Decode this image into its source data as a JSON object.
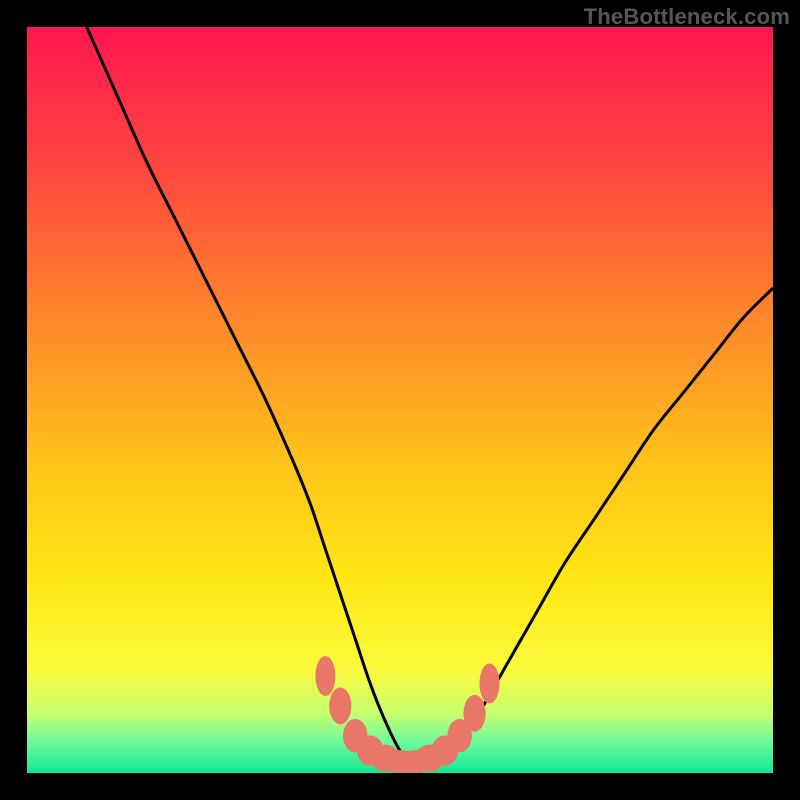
{
  "watermark": "TheBottleneck.com",
  "chart_data": {
    "type": "line",
    "title": "",
    "xlabel": "",
    "ylabel": "",
    "xlim": [
      0,
      100
    ],
    "ylim": [
      0,
      100
    ],
    "series": [
      {
        "name": "bottleneck-curve",
        "x": [
          8,
          12,
          16,
          20,
          24,
          28,
          32,
          36,
          38,
          40,
          42,
          44,
          46,
          48,
          50,
          52,
          54,
          56,
          58,
          60,
          64,
          68,
          72,
          76,
          80,
          84,
          88,
          92,
          96,
          100
        ],
        "y": [
          100,
          91,
          82,
          74,
          66,
          58,
          50,
          41,
          36,
          30,
          24,
          18,
          12,
          7,
          3,
          1,
          1,
          2,
          4,
          7,
          14,
          21,
          28,
          34,
          40,
          46,
          51,
          56,
          61,
          65
        ]
      },
      {
        "name": "marker-band",
        "x": [
          40,
          42,
          44,
          46,
          48,
          50,
          52,
          54,
          56,
          58,
          60,
          62
        ],
        "y": [
          13,
          9,
          5,
          3,
          2,
          1.5,
          1.5,
          2,
          3,
          5,
          8,
          12
        ]
      }
    ],
    "background_gradient": {
      "stops": [
        {
          "pos": 0.0,
          "color": "#ff1750"
        },
        {
          "pos": 0.2,
          "color": "#ff4a3f"
        },
        {
          "pos": 0.4,
          "color": "#ff8a2b"
        },
        {
          "pos": 0.58,
          "color": "#ffc21a"
        },
        {
          "pos": 0.74,
          "color": "#ffe714"
        },
        {
          "pos": 0.86,
          "color": "#fbfa3b"
        },
        {
          "pos": 0.92,
          "color": "#c7ff6f"
        },
        {
          "pos": 0.96,
          "color": "#6cf99c"
        },
        {
          "pos": 1.0,
          "color": "#12e896"
        }
      ]
    },
    "marker_color": "#e97768",
    "curve_color": "#000000"
  }
}
